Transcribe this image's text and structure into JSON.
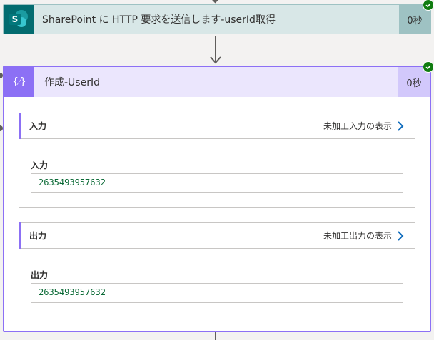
{
  "sharepoint_action": {
    "icon_name": "sharepoint-icon",
    "icon_letter": "S",
    "title": "SharePoint に HTTP 要求を送信します-userId取得",
    "duration": "0秒",
    "status": "succeeded"
  },
  "compose_action": {
    "icon_name": "compose-icon",
    "icon_glyph": "{⁄}",
    "title": "作成-UserId",
    "duration": "0秒",
    "status": "succeeded",
    "input_section": {
      "heading": "入力",
      "raw_link": "未加工入力の表示",
      "field_label": "入力",
      "field_value": "2635493957632"
    },
    "output_section": {
      "heading": "出力",
      "raw_link": "未加工出力の表示",
      "field_label": "出力",
      "field_value": "2635493957632"
    }
  },
  "colors": {
    "sharepoint_brand": "#036c70",
    "compose_brand": "#8c70f5",
    "success": "#107c10",
    "value_text": "#0b6a36"
  }
}
